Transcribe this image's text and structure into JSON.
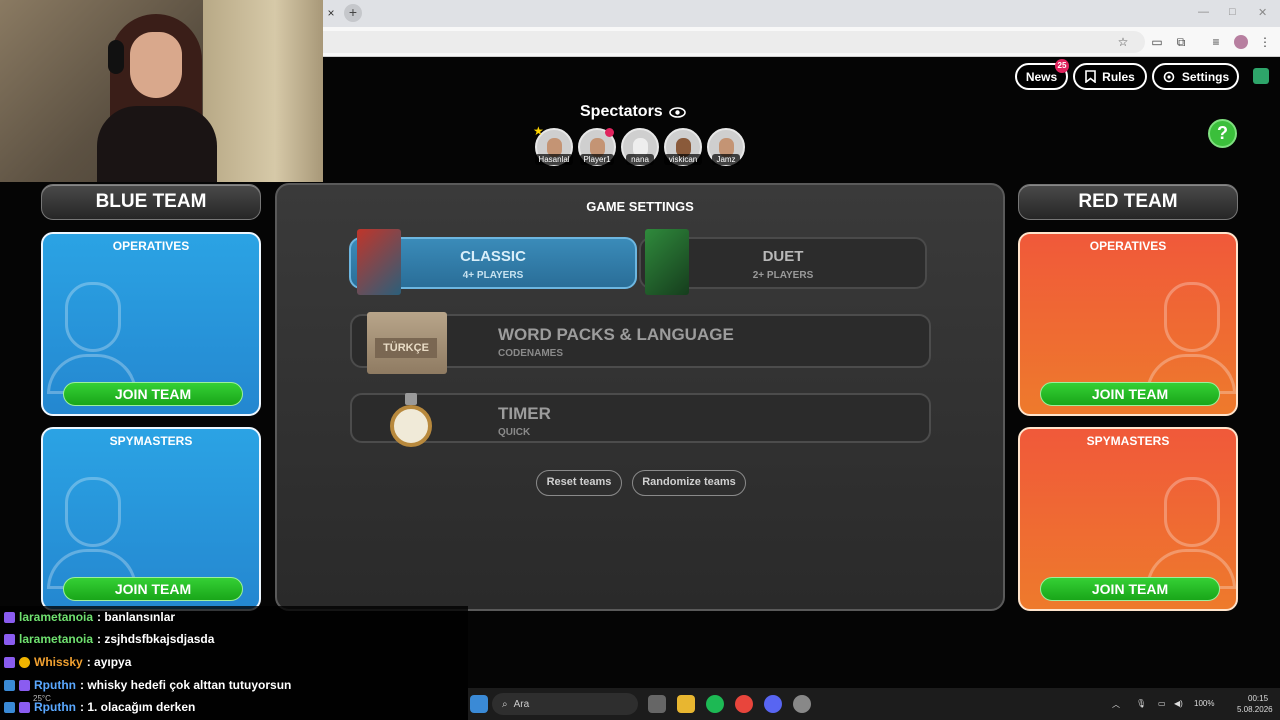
{
  "browser": {
    "close_glyph": "×",
    "new_tab_glyph": "+",
    "win_min": "—",
    "win_max": "□",
    "win_close": "✕"
  },
  "topbar": {
    "news_label": "News",
    "news_badge": "25",
    "rules_label": "Rules",
    "settings_label": "Settings",
    "help_label": "?"
  },
  "spectators": {
    "title": "Spectators",
    "people": [
      {
        "name": "Hasanlal"
      },
      {
        "name": "Player1"
      },
      {
        "name": "nana"
      },
      {
        "name": "viskican"
      },
      {
        "name": "Jamz"
      }
    ]
  },
  "blue_team": {
    "title": "BLUE TEAM",
    "operatives_label": "OPERATIVES",
    "spymasters_label": "SPYMASTERS",
    "join_label": "JOIN TEAM"
  },
  "red_team": {
    "title": "RED TEAM",
    "operatives_label": "OPERATIVES",
    "spymasters_label": "SPYMASTERS",
    "join_label": "JOIN TEAM"
  },
  "game_settings": {
    "title": "GAME SETTINGS",
    "modes": [
      {
        "name": "CLASSIC",
        "players": "4+ PLAYERS",
        "selected": true
      },
      {
        "name": "DUET",
        "players": "2+ PLAYERS",
        "selected": false
      }
    ],
    "word_packs": {
      "title": "WORD PACKS & LANGUAGE",
      "value": "CODENAMES",
      "crate_label": "TÜRKÇE"
    },
    "timer": {
      "title": "TIMER",
      "value": "QUICK"
    },
    "reset_label": "Reset teams",
    "randomize_label": "Randomize teams"
  },
  "chat": [
    {
      "user": "larametanoia",
      "color": "#6fe06f",
      "message": ": banlansınlar"
    },
    {
      "user": "larametanoia",
      "color": "#6fe06f",
      "message": ": zsjhdsfbkajsdjasda"
    },
    {
      "user": "Whissky",
      "color": "#f0a030",
      "message": ": ayıpya"
    },
    {
      "user": "Rputhn",
      "color": "#5aa8ff",
      "message": ": whisky hedefi çok alttan tutuyorsun"
    },
    {
      "user": "Rputhn",
      "color": "#5aa8ff",
      "message": ": 1. olacağım derken"
    }
  ],
  "taskbar": {
    "search_placeholder": "Ara",
    "weather": "25°C",
    "battery": "100%",
    "time": "00:15",
    "date": "5.08.2026"
  },
  "colors": {
    "blue_panel": "#2ba3e4",
    "red_panel": "#f0593a",
    "join_green": "#2ec42e",
    "badge_red": "#e0245e"
  }
}
